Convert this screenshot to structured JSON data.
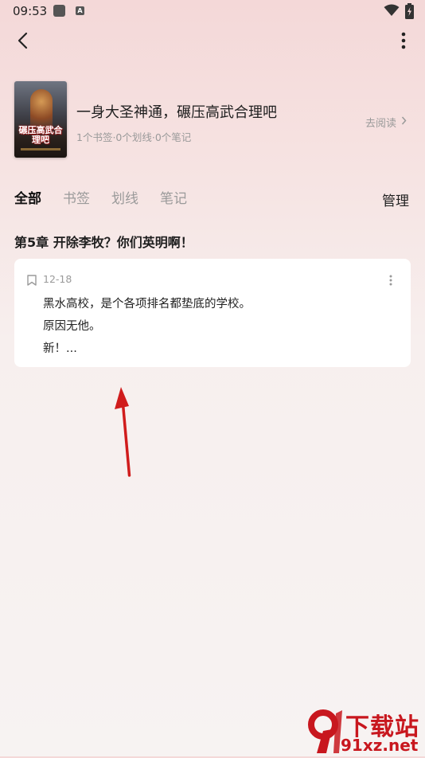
{
  "status_bar": {
    "time": "09:53",
    "badge_letter": "A"
  },
  "book": {
    "title": "一身大圣神通，碾压高武合理吧",
    "stats": "1个书签·0个划线·0个笔记",
    "read_link": "去阅读",
    "cover_text": "碾压高武合理吧"
  },
  "tabs": [
    {
      "label": "全部",
      "active": true
    },
    {
      "label": "书签",
      "active": false
    },
    {
      "label": "划线",
      "active": false
    },
    {
      "label": "笔记",
      "active": false
    }
  ],
  "manage_label": "管理",
  "chapter": {
    "title": "第5章 开除李牧？你们英明啊！"
  },
  "note": {
    "date": "12-18",
    "lines": [
      "黑水高校，是个各项排名都垫底的学校。",
      "原因无他。",
      "新！..."
    ]
  },
  "watermark": {
    "top_text": "下载站",
    "bottom_text": "91xz.net"
  },
  "colors": {
    "accent_red": "#c8171e",
    "annotation_arrow": "#d01c1c",
    "muted_text": "#9a9a9a"
  }
}
